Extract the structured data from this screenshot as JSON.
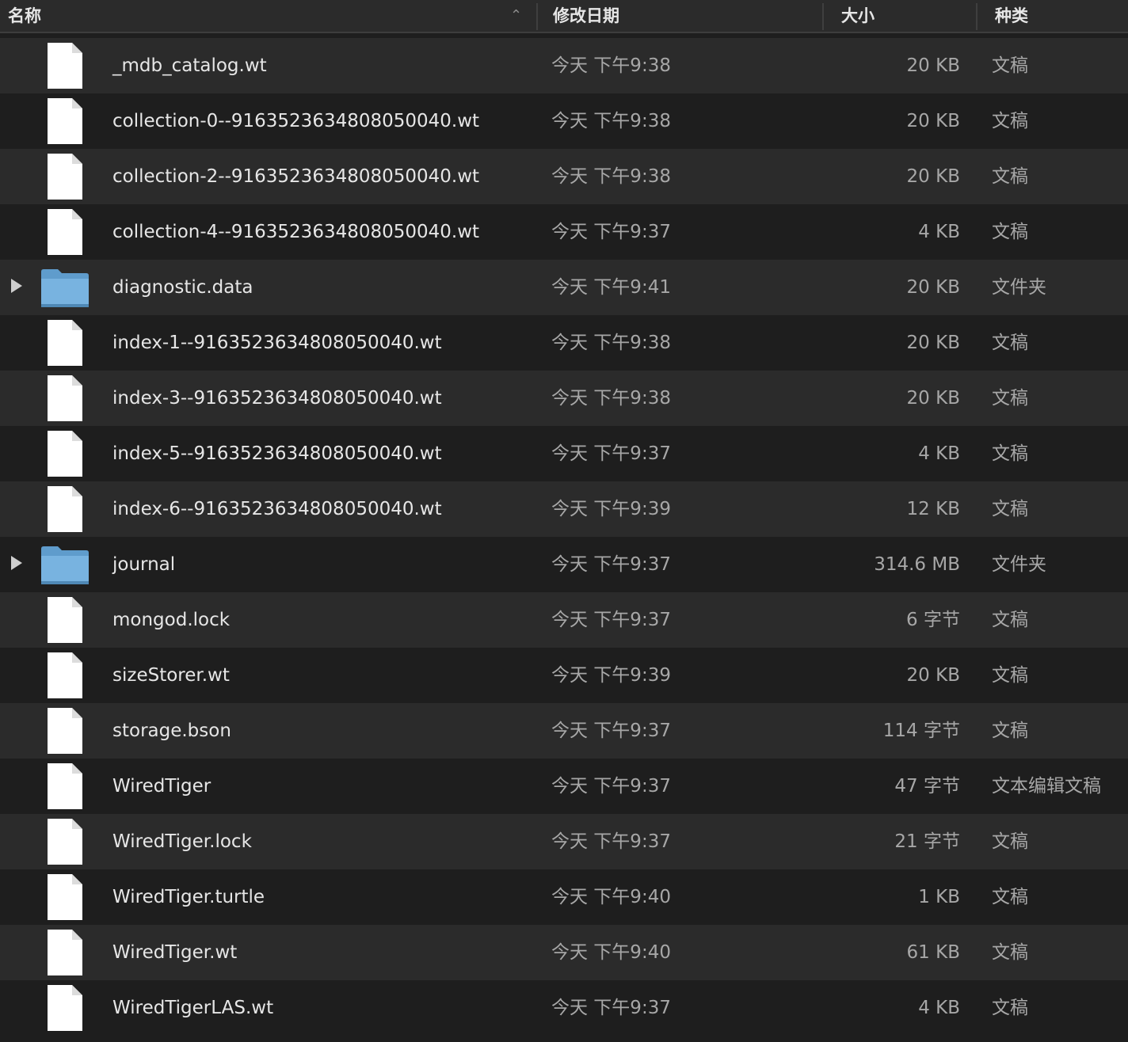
{
  "columns": {
    "name": "名称",
    "date": "修改日期",
    "size": "大小",
    "kind": "种类"
  },
  "sort": {
    "column": "name",
    "direction": "ascending",
    "indicator": "chevron-up-icon"
  },
  "files": [
    {
      "name": "_mdb_catalog.wt",
      "date": "今天 下午9:38",
      "size": "20 KB",
      "kind": "文稿",
      "type": "file"
    },
    {
      "name": "collection-0--9163523634808050040.wt",
      "date": "今天 下午9:38",
      "size": "20 KB",
      "kind": "文稿",
      "type": "file"
    },
    {
      "name": "collection-2--9163523634808050040.wt",
      "date": "今天 下午9:38",
      "size": "20 KB",
      "kind": "文稿",
      "type": "file"
    },
    {
      "name": "collection-4--9163523634808050040.wt",
      "date": "今天 下午9:37",
      "size": "4 KB",
      "kind": "文稿",
      "type": "file"
    },
    {
      "name": "diagnostic.data",
      "date": "今天 下午9:41",
      "size": "20 KB",
      "kind": "文件夹",
      "type": "folder"
    },
    {
      "name": "index-1--9163523634808050040.wt",
      "date": "今天 下午9:38",
      "size": "20 KB",
      "kind": "文稿",
      "type": "file"
    },
    {
      "name": "index-3--9163523634808050040.wt",
      "date": "今天 下午9:38",
      "size": "20 KB",
      "kind": "文稿",
      "type": "file"
    },
    {
      "name": "index-5--9163523634808050040.wt",
      "date": "今天 下午9:37",
      "size": "4 KB",
      "kind": "文稿",
      "type": "file"
    },
    {
      "name": "index-6--9163523634808050040.wt",
      "date": "今天 下午9:39",
      "size": "12 KB",
      "kind": "文稿",
      "type": "file"
    },
    {
      "name": "journal",
      "date": "今天 下午9:37",
      "size": "314.6 MB",
      "kind": "文件夹",
      "type": "folder"
    },
    {
      "name": "mongod.lock",
      "date": "今天 下午9:37",
      "size": "6 字节",
      "kind": "文稿",
      "type": "file"
    },
    {
      "name": "sizeStorer.wt",
      "date": "今天 下午9:39",
      "size": "20 KB",
      "kind": "文稿",
      "type": "file"
    },
    {
      "name": "storage.bson",
      "date": "今天 下午9:37",
      "size": "114 字节",
      "kind": "文稿",
      "type": "file"
    },
    {
      "name": "WiredTiger",
      "date": "今天 下午9:37",
      "size": "47 字节",
      "kind": "文本编辑文稿",
      "type": "file"
    },
    {
      "name": "WiredTiger.lock",
      "date": "今天 下午9:37",
      "size": "21 字节",
      "kind": "文稿",
      "type": "file"
    },
    {
      "name": "WiredTiger.turtle",
      "date": "今天 下午9:40",
      "size": "1 KB",
      "kind": "文稿",
      "type": "file"
    },
    {
      "name": "WiredTiger.wt",
      "date": "今天 下午9:40",
      "size": "61 KB",
      "kind": "文稿",
      "type": "file"
    },
    {
      "name": "WiredTigerLAS.wt",
      "date": "今天 下午9:37",
      "size": "4 KB",
      "kind": "文稿",
      "type": "file"
    }
  ],
  "colors": {
    "background": "#1e1e1e",
    "row_alt": "#2b2b2b",
    "folder": "#6fa8d6",
    "file": "#ffffff"
  }
}
